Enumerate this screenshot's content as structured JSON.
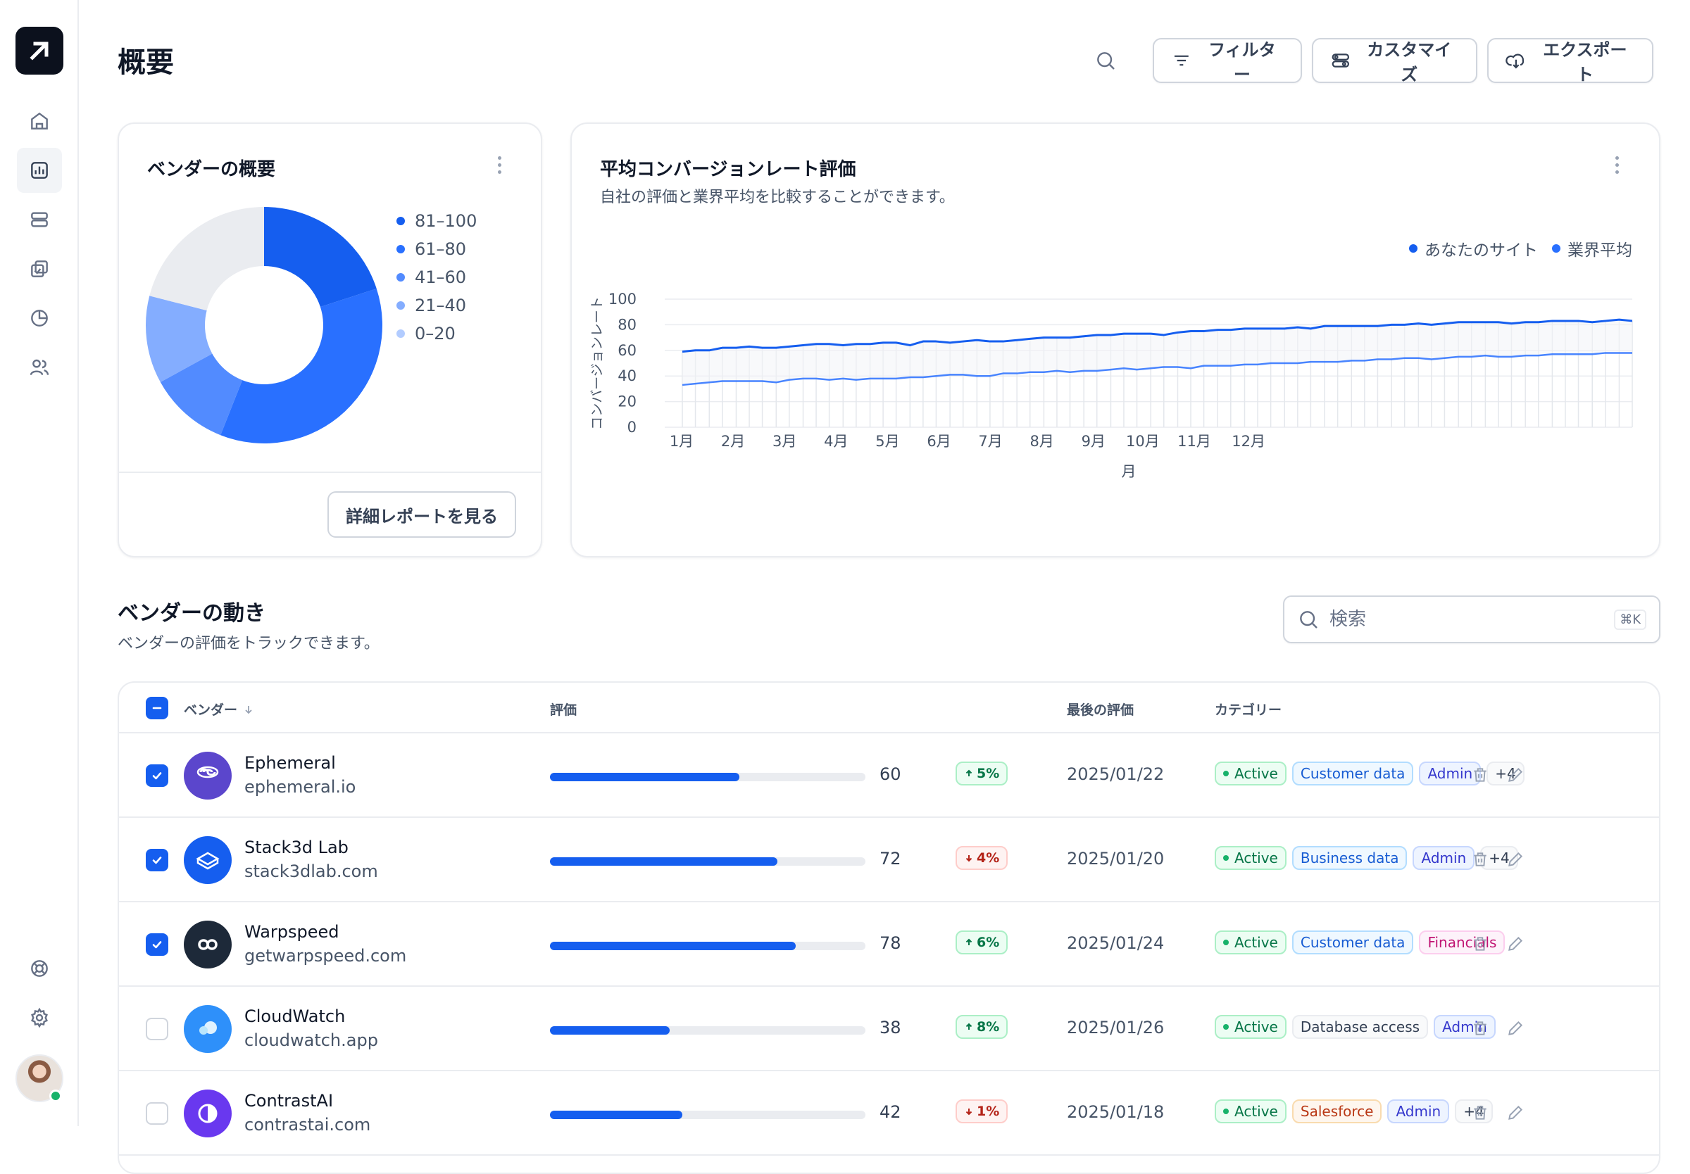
{
  "page": {
    "title": "概要"
  },
  "sidebar": {
    "nav": [
      {
        "name": "home-icon",
        "active": false
      },
      {
        "name": "bar-chart-icon",
        "active": true
      },
      {
        "name": "layers-icon",
        "active": false
      },
      {
        "name": "check-copy-icon",
        "active": false
      },
      {
        "name": "pie-chart-icon",
        "active": false
      },
      {
        "name": "users-icon",
        "active": false
      }
    ],
    "bottom": [
      "life-buoy-icon",
      "settings-icon"
    ],
    "user_status": "online"
  },
  "toolbar": {
    "filter_label": "フィルター",
    "customize_label": "カスタマイズ",
    "export_label": "エクスポート"
  },
  "vendor_overview": {
    "title": "ベンダーの概要",
    "report_button": "詳細レポートを見る",
    "legend": [
      {
        "label": "81–100",
        "color": "#155eef"
      },
      {
        "label": "61–80",
        "color": "#2970ff"
      },
      {
        "label": "41–60",
        "color": "#528bff"
      },
      {
        "label": "21–40",
        "color": "#84adff"
      },
      {
        "label": "0–20",
        "color": "#b2ccff"
      }
    ]
  },
  "conversion": {
    "title": "平均コンバージョンレート評価",
    "subtitle": "自社の評価と業界平均を比較することができます。",
    "legend_site": "あなたのサイト",
    "legend_industry": "業界平均"
  },
  "chart_data": [
    {
      "type": "pie",
      "title": "ベンダーの概要",
      "donut": true,
      "categories": [
        "81–100",
        "61–80",
        "41–60",
        "21–40",
        "0–20"
      ],
      "values": [
        20,
        36,
        11,
        12,
        21
      ],
      "colors": [
        "#155eef",
        "#2970ff",
        "#528bff",
        "#84adff",
        "#eaecf0"
      ]
    },
    {
      "type": "line",
      "title": "平均コンバージョンレート評価",
      "xlabel": "月",
      "ylabel": "コンバージョンレート",
      "ylim": [
        0,
        100
      ],
      "yticks": [
        0,
        20,
        40,
        60,
        80,
        100
      ],
      "grid": true,
      "legend": "top-right",
      "categories": [
        "1月",
        "2月",
        "3月",
        "4月",
        "5月",
        "6月",
        "7月",
        "8月",
        "9月",
        "10月",
        "11月",
        "12月"
      ],
      "x": [
        0.0,
        0.16,
        0.33,
        0.49,
        0.66,
        0.82,
        0.98,
        1.15,
        1.31,
        1.48,
        1.64,
        1.8,
        1.97,
        2.13,
        2.3,
        2.46,
        2.62,
        2.79,
        2.95,
        3.11,
        3.28,
        3.44,
        3.61,
        3.77,
        3.93,
        4.1,
        4.26,
        4.43,
        4.59,
        4.75,
        4.92,
        5.08,
        5.25,
        5.41,
        5.57,
        5.74,
        5.9,
        6.07,
        6.23,
        6.39,
        6.56,
        6.72,
        6.89,
        7.05,
        7.21,
        7.38,
        7.54,
        7.7,
        7.87,
        8.03,
        8.2,
        8.36,
        8.52,
        8.69,
        8.85,
        9.02,
        9.18,
        9.34,
        9.51,
        9.67,
        9.84,
        10.0,
        10.16,
        10.33,
        10.49,
        10.66,
        10.82,
        10.98,
        11.15,
        11.31,
        11.48,
        11.64
      ],
      "series": [
        {
          "name": "あなたのサイト",
          "color": "#155eef",
          "values": [
            59,
            60,
            60,
            62,
            62,
            63,
            62,
            62,
            63,
            64,
            65,
            65,
            64,
            65,
            65,
            66,
            66,
            64,
            67,
            67,
            66,
            67,
            68,
            67,
            67,
            68,
            69,
            70,
            70,
            70,
            71,
            72,
            72,
            73,
            73,
            73,
            72,
            74,
            75,
            75,
            76,
            76,
            77,
            77,
            77,
            77,
            78,
            77,
            79,
            79,
            79,
            79,
            79,
            80,
            80,
            81,
            80,
            81,
            82,
            82,
            82,
            82,
            81,
            82,
            82,
            83,
            83,
            83,
            82,
            83,
            84,
            83
          ]
        },
        {
          "name": "業界平均",
          "color": "#2970ff",
          "values": [
            33,
            34,
            35,
            36,
            36,
            36,
            36,
            35,
            37,
            38,
            38,
            37,
            38,
            37,
            38,
            38,
            38,
            39,
            39,
            40,
            41,
            41,
            40,
            40,
            42,
            42,
            43,
            43,
            44,
            43,
            44,
            44,
            45,
            46,
            45,
            46,
            47,
            47,
            46,
            48,
            48,
            48,
            49,
            49,
            50,
            50,
            50,
            51,
            51,
            51,
            52,
            52,
            53,
            53,
            54,
            54,
            53,
            54,
            55,
            55,
            56,
            55,
            55,
            56,
            56,
            57,
            57,
            57,
            57,
            58,
            58,
            58
          ]
        }
      ]
    }
  ],
  "activity": {
    "title": "ベンダーの動き",
    "subtitle": "ベンダーの評価をトラックできます。",
    "search_placeholder": "検索",
    "search_shortcut": "⌘K",
    "columns": {
      "vendor": "ベンダー",
      "rating": "評価",
      "last_rating": "最後の評価",
      "category": "カテゴリー"
    },
    "rows": [
      {
        "name": "Ephemeral",
        "domain": "ephemeral.io",
        "checked": true,
        "score": 60,
        "score_label": "60",
        "trend": "up",
        "trend_label": "5%",
        "date": "2025/01/22",
        "logo_bg": "#5b46cc",
        "logo_icon": "ephemeral-logo-icon",
        "tags": [
          {
            "label": "Active",
            "style": "active"
          },
          {
            "label": "Customer data",
            "style": "blue"
          },
          {
            "label": "Admin",
            "style": "indigo"
          },
          {
            "label": "+4",
            "style": "gray"
          }
        ]
      },
      {
        "name": "Stack3d Lab",
        "domain": "stack3dlab.com",
        "checked": true,
        "score": 72,
        "score_label": "72",
        "trend": "down",
        "trend_label": "4%",
        "date": "2025/01/20",
        "logo_bg": "#155eef",
        "logo_icon": "stack3d-logo-icon",
        "tags": [
          {
            "label": "Active",
            "style": "active"
          },
          {
            "label": "Business data",
            "style": "blue"
          },
          {
            "label": "Admin",
            "style": "indigo"
          },
          {
            "label": "+4",
            "style": "gray"
          }
        ]
      },
      {
        "name": "Warpspeed",
        "domain": "getwarpspeed.com",
        "checked": true,
        "score": 78,
        "score_label": "78",
        "trend": "up",
        "trend_label": "6%",
        "date": "2025/01/24",
        "logo_bg": "#1d2939",
        "logo_icon": "warpspeed-logo-icon",
        "tags": [
          {
            "label": "Active",
            "style": "active"
          },
          {
            "label": "Customer data",
            "style": "blue"
          },
          {
            "label": "Financials",
            "style": "pink"
          }
        ]
      },
      {
        "name": "CloudWatch",
        "domain": "cloudwatch.app",
        "checked": false,
        "score": 38,
        "score_label": "38",
        "trend": "up",
        "trend_label": "8%",
        "date": "2025/01/26",
        "logo_bg": "#2e90fa",
        "logo_icon": "cloudwatch-logo-icon",
        "tags": [
          {
            "label": "Active",
            "style": "active"
          },
          {
            "label": "Database access",
            "style": "gray"
          },
          {
            "label": "Admin",
            "style": "indigo"
          }
        ]
      },
      {
        "name": "ContrastAI",
        "domain": "contrastai.com",
        "checked": false,
        "score": 42,
        "score_label": "42",
        "trend": "down",
        "trend_label": "1%",
        "date": "2025/01/18",
        "logo_bg": "#6938ef",
        "logo_icon": "contrastai-logo-icon",
        "tags": [
          {
            "label": "Active",
            "style": "active"
          },
          {
            "label": "Salesforce",
            "style": "orange"
          },
          {
            "label": "Admin",
            "style": "indigo"
          },
          {
            "label": "+4",
            "style": "gray"
          }
        ]
      }
    ]
  }
}
